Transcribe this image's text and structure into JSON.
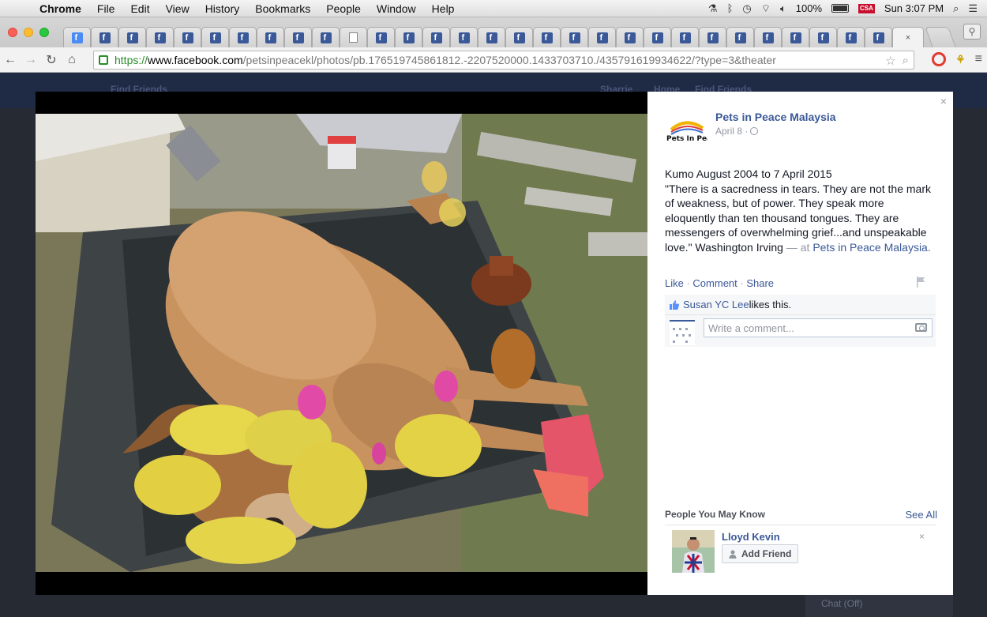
{
  "menubar": {
    "app": "Chrome",
    "items": [
      "File",
      "Edit",
      "View",
      "History",
      "Bookmarks",
      "People",
      "Window",
      "Help"
    ],
    "battery": "100%",
    "input_source": "CSA",
    "clock": "Sun 3:07 PM"
  },
  "browser": {
    "url_scheme": "https://",
    "url_host": "www.facebook.com",
    "url_path": "/petsinpeacekl/photos/pb.176519745861812.-2207520000.1433703710./435791619934622/?type=3&theater",
    "fb_tab_glyph": "f",
    "active_tab_close": "×"
  },
  "post": {
    "page_name": "Pets in Peace Malaysia",
    "logo_text": "Pets In Peace",
    "date": "April 8 ·",
    "lines": [
      "Kumo August 2004 to 7 April 2015",
      "\"There is a sacredness in tears. They are not the mark of weakness, but of power. They speak more eloquently than ten thousand tongues. They are messengers of overwhelming grief...and unspeakable love.\" Washington Irving"
    ],
    "at_prefix": " — at ",
    "location": "Pets in Peace Malaysia.",
    "like": "Like",
    "comment": "Comment",
    "share": "Share",
    "sep": " · ",
    "liker": "Susan YC Lee",
    "likes_suffix": " likes this.",
    "comment_placeholder": "Write a comment..."
  },
  "pymk": {
    "title": "People You May Know",
    "see_all": "See All",
    "name": "Lloyd Kevin",
    "add_friend": "Add Friend"
  },
  "panel": {
    "close": "×",
    "dismiss": "×"
  },
  "fb_header_ghost": [
    "Find Friends",
    "Sharrie",
    "Home",
    "Find Friends"
  ],
  "chat": "Chat (Off)",
  "colors": {
    "fb_blue": "#3b5998",
    "link_green": "#2a8b2a"
  }
}
